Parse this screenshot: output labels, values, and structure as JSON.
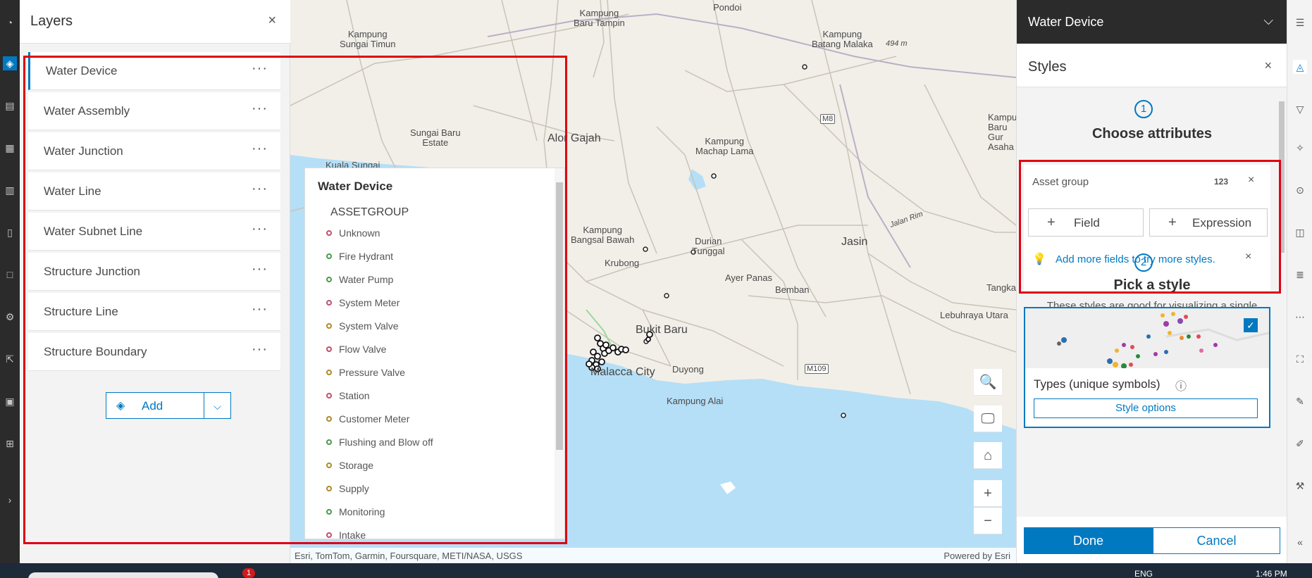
{
  "layers_panel": {
    "title": "Layers",
    "close_icon": "×",
    "items": [
      {
        "label": "Water Device",
        "more": "···"
      },
      {
        "label": "Water Assembly",
        "more": "···"
      },
      {
        "label": "Water Junction",
        "more": "···"
      },
      {
        "label": "Water Line",
        "more": "···"
      },
      {
        "label": "Water Subnet Line",
        "more": "···"
      },
      {
        "label": "Structure Junction",
        "more": "···"
      },
      {
        "label": "Structure Line",
        "more": "···"
      },
      {
        "label": "Structure Boundary",
        "more": "···"
      }
    ],
    "add_label": "Add",
    "add_dropdown": "⌵"
  },
  "map": {
    "labels": {
      "kampung_sungai_timun": "Kampung\nSungai Timun",
      "kampung_baru_tampin": "Kampung\nBaru Tampin",
      "pondoi": "Pondoi",
      "kampung_batang_malaka": "Kampung\nBatang Malaka",
      "elev_494": "494 m",
      "sungai_baru_estate": "Sungai Baru\nEstate",
      "alor_gajah": "Alor Gajah",
      "kampung_machap_lama": "Kampung\nMachap Lama",
      "kampung_baru_gur": "Kampu\nBaru Gur\nAsaha",
      "kuala_sungai": "Kuala Sungai",
      "jalan_rim": "Jalan Rim",
      "kampung_bangsal_bawah": "Kampung\nBangsal Bawah",
      "durian_tunggal": "Durian\nTunggal",
      "jasin": "Jasin",
      "krubong": "Krubong",
      "ayer_panas": "Ayer Panas",
      "tangka": "Tangka",
      "bemban": "Bemban",
      "lebuhraya": "Lebuhraya Utara",
      "bukit_baru": "Bukit Baru",
      "malacca_city": "Malacca City",
      "duyong": "Duyong",
      "kampung_alai": "Kampung Alai"
    },
    "shields": {
      "m8": "M8",
      "m109": "M109"
    },
    "controls": {
      "search": "🔍",
      "screen": "🖵",
      "home": "⌂",
      "zoom_in": "+",
      "zoom_out": "−"
    },
    "attribution": "Esri, TomTom, Garmin, Foursquare, METI/NASA, USGS",
    "powered_by": "Powered by Esri"
  },
  "legend": {
    "title": "Water Device",
    "field": "ASSETGROUP",
    "items": [
      {
        "label": "Unknown",
        "color": "#c0506a"
      },
      {
        "label": "Fire Hydrant",
        "color": "#4a9a4a"
      },
      {
        "label": "Water Pump",
        "color": "#4a9a4a"
      },
      {
        "label": "System Meter",
        "color": "#c0506a"
      },
      {
        "label": "System Valve",
        "color": "#b08a2a"
      },
      {
        "label": "Flow Valve",
        "color": "#c0506a"
      },
      {
        "label": "Pressure Valve",
        "color": "#b08a2a"
      },
      {
        "label": "Station",
        "color": "#c0506a"
      },
      {
        "label": "Customer Meter",
        "color": "#b08a2a"
      },
      {
        "label": "Flushing and Blow off",
        "color": "#4a9a4a"
      },
      {
        "label": "Storage",
        "color": "#b08a2a"
      },
      {
        "label": "Supply",
        "color": "#b08a2a"
      },
      {
        "label": "Monitoring",
        "color": "#4a9a4a"
      },
      {
        "label": "Intake",
        "color": "#c0506a"
      }
    ]
  },
  "styles_panel": {
    "layer_name": "Water Device",
    "layer_chevron": "⌵",
    "title": "Styles",
    "close_icon": "×",
    "step1": {
      "num": "1",
      "title": "Choose attributes"
    },
    "attribute": {
      "name": "Asset group",
      "type": "123",
      "remove": "×"
    },
    "field_btn": "Field",
    "expression_btn": "Expression",
    "tip": {
      "text": "Add more fields to try more styles.",
      "close": "×"
    },
    "step2": {
      "num": "2",
      "title": "Pick a style"
    },
    "style_desc": "These styles are good for visualizing a single numeric field.",
    "style_card": {
      "name": "Types (unique symbols)",
      "info": "ⓘ",
      "check": "✓",
      "options": "Style options"
    },
    "done": "Done",
    "cancel": "Cancel"
  },
  "taskbar": {
    "badge": "1",
    "lang": "ENG",
    "time": "1:46 PM"
  },
  "colors": {
    "accent": "#0079c1",
    "highlight": "#e00012",
    "water": "#b5dff6"
  }
}
